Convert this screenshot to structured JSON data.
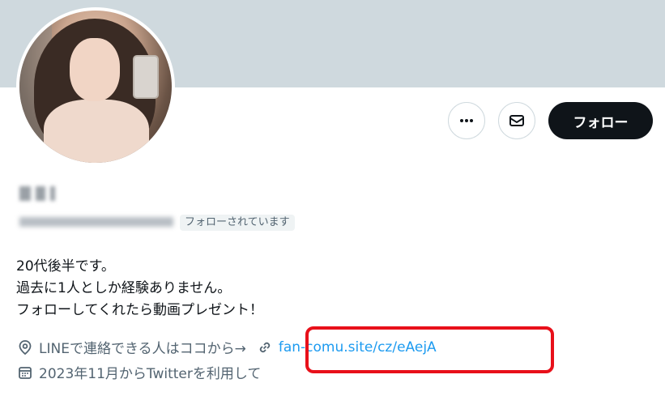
{
  "profile": {
    "bio_lines": [
      "20代後半です。",
      "過去に1人としか経験ありません。",
      "フォローしてくれたら動画プレゼント！"
    ],
    "follows_you_badge": "フォローされています",
    "location_text": "LINEで連絡できる人はココから→",
    "link_text": "fan-comu.site/cz/eAejA",
    "joined_text": "2023年11月からTwitterを利用して"
  },
  "actions": {
    "more_icon": "more-horizontal-icon",
    "message_icon": "mail-icon",
    "follow_label": "フォロー"
  },
  "colors": {
    "banner": "#cfd9de",
    "link": "#1d9bf0",
    "follow_button": "#0f1419",
    "highlight": "#e8101a"
  }
}
